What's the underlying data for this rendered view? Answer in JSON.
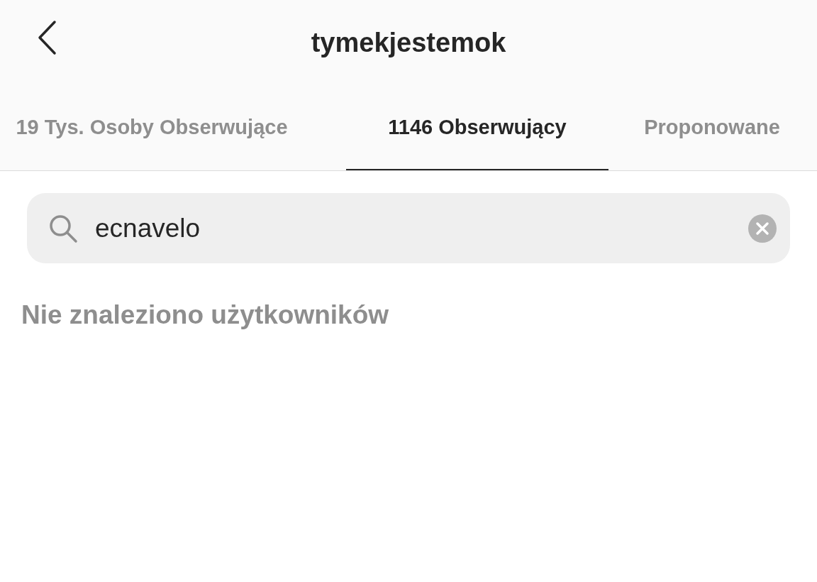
{
  "header": {
    "title": "tymekjestemok"
  },
  "tabs": [
    {
      "label": "19 Tys. Osoby Obserwujące",
      "selected": false
    },
    {
      "label": "1146 Obserwujący",
      "selected": true
    },
    {
      "label": "Proponowane",
      "selected": false
    }
  ],
  "search": {
    "value": "ecnavelo"
  },
  "message": "Nie znaleziono użytkowników"
}
